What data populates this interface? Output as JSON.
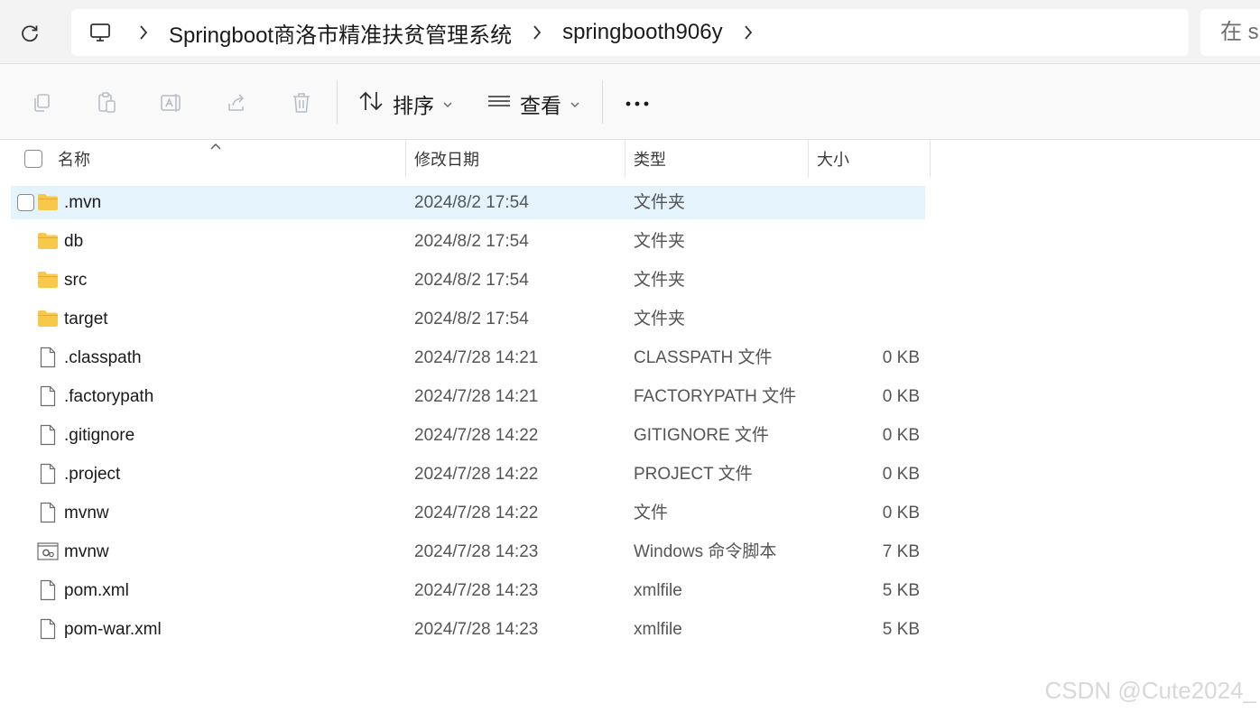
{
  "address": {
    "crumbs": [
      "Springboot商洛市精准扶贫管理系统",
      "springbooth906y"
    ],
    "search_text": "在 s"
  },
  "toolbar": {
    "sort_label": "排序",
    "view_label": "查看"
  },
  "columns": {
    "name": "名称",
    "date": "修改日期",
    "type": "类型",
    "size": "大小"
  },
  "files": [
    {
      "name": ".mvn",
      "date": "2024/8/2 17:54",
      "type": "文件夹",
      "size": "",
      "icon": "folder-icon",
      "selected": true
    },
    {
      "name": "db",
      "date": "2024/8/2 17:54",
      "type": "文件夹",
      "size": "",
      "icon": "folder-icon"
    },
    {
      "name": "src",
      "date": "2024/8/2 17:54",
      "type": "文件夹",
      "size": "",
      "icon": "folder-icon"
    },
    {
      "name": "target",
      "date": "2024/8/2 17:54",
      "type": "文件夹",
      "size": "",
      "icon": "folder-icon"
    },
    {
      "name": ".classpath",
      "date": "2024/7/28 14:21",
      "type": "CLASSPATH 文件",
      "size": "0 KB",
      "icon": "file-icon"
    },
    {
      "name": ".factorypath",
      "date": "2024/7/28 14:21",
      "type": "FACTORYPATH 文件",
      "size": "0 KB",
      "icon": "file-icon"
    },
    {
      "name": ".gitignore",
      "date": "2024/7/28 14:22",
      "type": "GITIGNORE 文件",
      "size": "0 KB",
      "icon": "file-icon"
    },
    {
      "name": ".project",
      "date": "2024/7/28 14:22",
      "type": "PROJECT 文件",
      "size": "0 KB",
      "icon": "file-icon"
    },
    {
      "name": "mvnw",
      "date": "2024/7/28 14:22",
      "type": "文件",
      "size": "0 KB",
      "icon": "file-icon"
    },
    {
      "name": "mvnw",
      "date": "2024/7/28 14:23",
      "type": "Windows 命令脚本",
      "size": "7 KB",
      "icon": "script-file-icon"
    },
    {
      "name": "pom.xml",
      "date": "2024/7/28 14:23",
      "type": "xmlfile",
      "size": "5 KB",
      "icon": "file-icon"
    },
    {
      "name": "pom-war.xml",
      "date": "2024/7/28 14:23",
      "type": "xmlfile",
      "size": "5 KB",
      "icon": "file-icon"
    }
  ],
  "watermark": "CSDN @Cute2024_",
  "colors": {
    "selection": "#e5f3fd",
    "folder": "#f8c84a",
    "toolbar_icon_disabled": "#b8bec6"
  }
}
